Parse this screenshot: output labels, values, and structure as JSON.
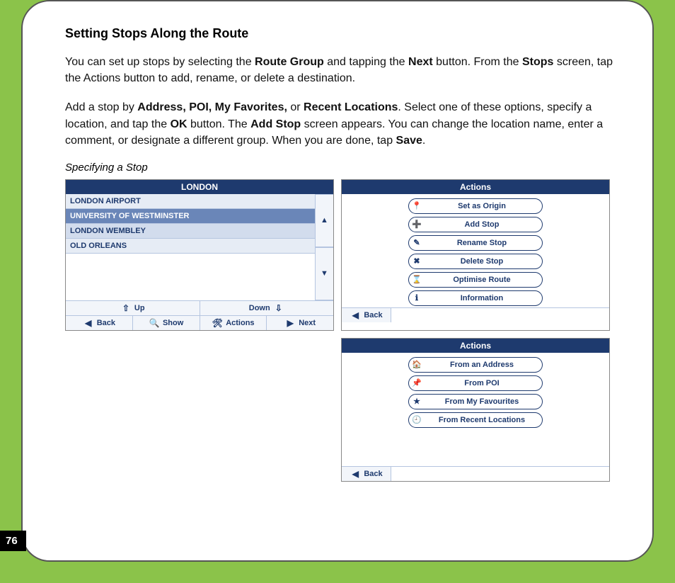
{
  "page_number": "76",
  "heading": "Setting Stops Along the Route",
  "para1_parts": [
    "You can set up stops by selecting the ",
    "Route Group",
    " and tapping the ",
    "Next",
    " button. From the ",
    "Stops",
    " screen, tap the Actions button to add, rename, or delete a destination."
  ],
  "para2_parts": [
    "Add a stop by ",
    "Address, POI, My Favorites,",
    " or ",
    "Recent Locations",
    ". Select one of these options, specify a location, and tap the ",
    "OK",
    " button. The ",
    "Add Stop",
    " screen appears. You can change the location name, enter a comment, or designate a different group. When you are done, tap ",
    "Save",
    "."
  ],
  "caption": "Specifying a Stop",
  "screenA": {
    "title": "LONDON",
    "items": [
      {
        "label": "LONDON AIRPORT",
        "cls": "alt2"
      },
      {
        "label": "UNIVERSITY OF WESTMINSTER",
        "cls": "sel"
      },
      {
        "label": "LONDON WEMBLEY",
        "cls": "alt1"
      },
      {
        "label": "OLD ORLEANS",
        "cls": "alt2"
      }
    ],
    "up": "Up",
    "down": "Down",
    "back": "Back",
    "show": "Show",
    "actions": "Actions",
    "next": "Next"
  },
  "screenB": {
    "title": "Actions",
    "buttons": [
      {
        "label": "Set as Origin",
        "icon": "📍",
        "name": "set-origin"
      },
      {
        "label": "Add Stop",
        "icon": "➕",
        "name": "add-stop"
      },
      {
        "label": "Rename Stop",
        "icon": "✎",
        "name": "rename-stop"
      },
      {
        "label": "Delete Stop",
        "icon": "✖",
        "name": "delete-stop"
      },
      {
        "label": "Optimise Route",
        "icon": "⌛",
        "name": "optimise-route"
      },
      {
        "label": "Information",
        "icon": "ℹ",
        "name": "information"
      }
    ],
    "back": "Back"
  },
  "screenC": {
    "title": "Actions",
    "buttons": [
      {
        "label": "From an Address",
        "icon": "🏠",
        "name": "from-address"
      },
      {
        "label": "From POI",
        "icon": "📌",
        "name": "from-poi"
      },
      {
        "label": "From My Favourites",
        "icon": "★",
        "name": "from-favourites"
      },
      {
        "label": "From Recent Locations",
        "icon": "🕘",
        "name": "from-recent"
      }
    ],
    "back": "Back"
  }
}
